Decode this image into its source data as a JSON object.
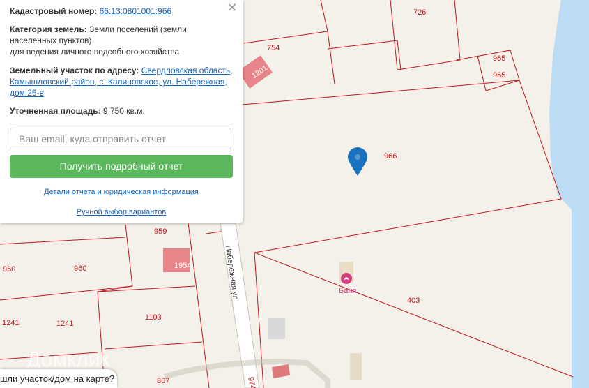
{
  "panel": {
    "close_icon": "close-icon",
    "cadastral_label": "Кадастровый номер:",
    "cadastral_value": "66:13:0801001:966",
    "category_label": "Категория земель:",
    "category_value_1": "Земли поселений (земли",
    "category_value_2": "населенных пунктов)",
    "category_value_3": "для ведения личного подсобного хозяйства",
    "address_label": "Земельный участок по адресу:",
    "address_line_1": "Свердловская область,",
    "address_line_2": "Камышловский район, с. Калиновское, ул. Набережная,",
    "address_line_3": "дом 26-в",
    "area_label": "Уточненная площадь:",
    "area_value": "9 750 кв.м.",
    "email_placeholder": "Ваш email, куда отправить отчет",
    "submit_label": "Получить подробный отчет",
    "details_link": "Детали отчета и юридическая информация",
    "manual_link": "Ручной выбор вариантов"
  },
  "help": {
    "text": "шли участок/дом на карте?"
  },
  "map": {
    "parcels": [
      "726",
      "754",
      "965",
      "965",
      "966",
      "959",
      "960",
      "960",
      "403",
      "1241",
      "1241",
      "1103",
      "867",
      "974"
    ],
    "buildings": [
      "1201",
      "1954"
    ],
    "street": "Набережная ул.",
    "poi": "Баня",
    "poi_icon": "lotus-icon",
    "marker_icon": "map-pin-icon",
    "watermark": "Домклик",
    "colors": {
      "parcel_line": "#c0161e",
      "water": "#bcdcf4",
      "building": "#e8858a",
      "button": "#5cb85c",
      "link": "#1a64b6"
    }
  }
}
